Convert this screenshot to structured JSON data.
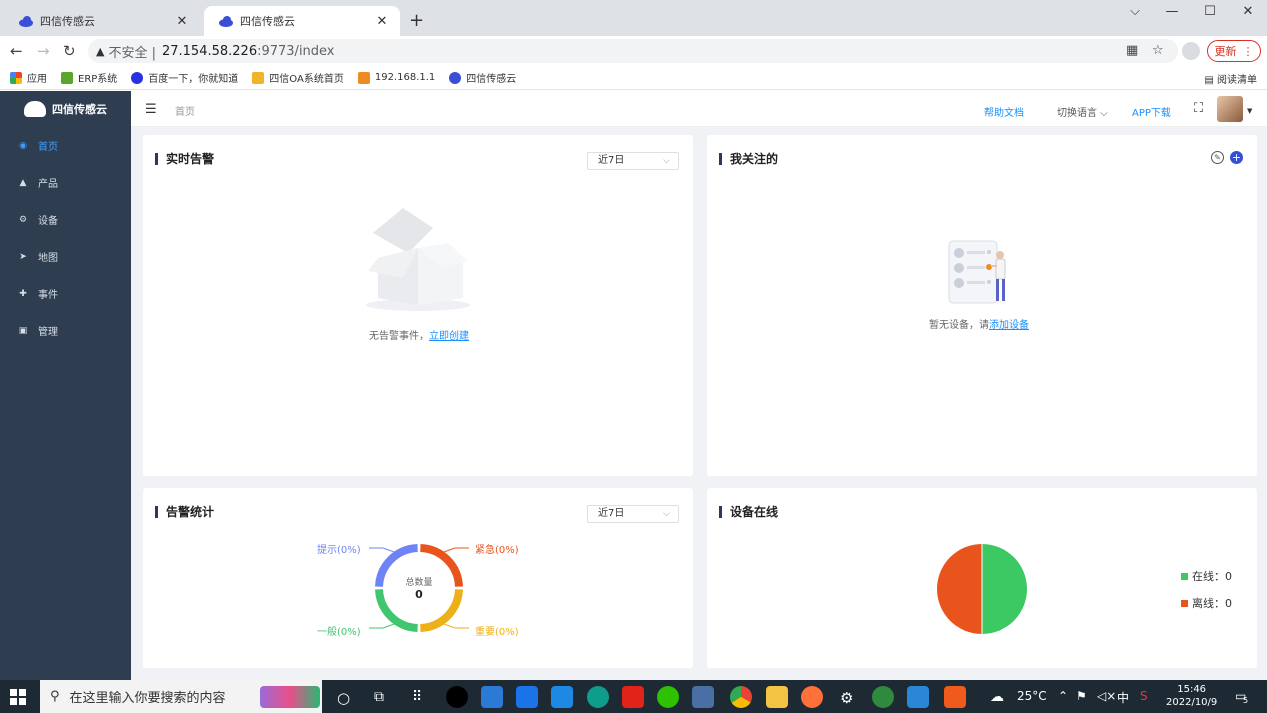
{
  "browser": {
    "tabs": [
      {
        "title": "四信传感云",
        "active": false
      },
      {
        "title": "四信传感云",
        "active": true
      }
    ],
    "new_tab": "+",
    "window_controls": {
      "dropdown": "⌵",
      "minimize": "—",
      "maximize": "☐",
      "close": "✕"
    },
    "address": {
      "warning": "▲",
      "insecure_label": "不安全 |",
      "host": "27.154.58.226",
      "path": ":9773/index"
    },
    "update_button": "更新",
    "bookmarks": [
      {
        "label": "应用",
        "color": "#4285f4"
      },
      {
        "label": "ERP系统",
        "color": "#5aa62c"
      },
      {
        "label": "百度一下，你就知道",
        "color": "#2932e1"
      },
      {
        "label": "四信OA系统首页",
        "color": "#f0b429"
      },
      {
        "label": "192.168.1.1",
        "color": "#f08a24"
      },
      {
        "label": "四信传感云",
        "color": "#3a4fd6"
      }
    ],
    "reading_list": "阅读清单"
  },
  "app": {
    "logo_text": "四信传感云",
    "menu": [
      {
        "label": "首页",
        "icon": "dashboard-icon",
        "glyph": "◉",
        "active": true
      },
      {
        "label": "产品",
        "icon": "product-icon",
        "glyph": "▲",
        "active": false
      },
      {
        "label": "设备",
        "icon": "device-icon",
        "glyph": "⚙",
        "active": false
      },
      {
        "label": "地图",
        "icon": "map-icon",
        "glyph": "➤",
        "active": false
      },
      {
        "label": "事件",
        "icon": "event-icon",
        "glyph": "✚",
        "active": false
      },
      {
        "label": "管理",
        "icon": "manage-icon",
        "glyph": "▣",
        "active": false
      }
    ],
    "header": {
      "breadcrumb": "首页",
      "help": "帮助文档",
      "language": "切换语言 ⌵",
      "app_download": "APP下载",
      "fullscreen": "⛶"
    }
  },
  "cards": {
    "realtime_alarm": {
      "title": "实时告警",
      "range": "近7日",
      "empty_text": "无告警事件，",
      "empty_link": "立即创建"
    },
    "followed": {
      "title": "我关注的",
      "empty_text": "暂无设备，请",
      "empty_link": "添加设备"
    },
    "alarm_stats": {
      "title": "告警统计",
      "range": "近7日",
      "center_label": "总数量",
      "center_value": "0",
      "labels": {
        "hint": "提示(0%)",
        "urgent": "紧急(0%)",
        "normal": "一般(0%)",
        "important": "重要(0%)"
      },
      "colors": {
        "hint": "#6e83f5",
        "urgent": "#e8541c",
        "normal": "#3fc66e",
        "important": "#eeb019"
      }
    },
    "device_online": {
      "title": "设备在线",
      "legend": {
        "online": "在线：0",
        "offline": "离线：0"
      },
      "colors": {
        "online": "#3cc863",
        "offline": "#e8541c"
      }
    }
  },
  "chart_data": [
    {
      "type": "pie",
      "title": "告警统计",
      "categories": [
        "提示",
        "紧急",
        "重要",
        "一般"
      ],
      "values": [
        0,
        0,
        0,
        0
      ],
      "total": 0
    },
    {
      "type": "pie",
      "title": "设备在线",
      "categories": [
        "在线",
        "离线"
      ],
      "values": [
        0,
        0
      ]
    }
  ],
  "taskbar": {
    "search_placeholder": "在这里输入你要搜索的内容",
    "weather": "25°C",
    "ime": "中",
    "time": "15:46",
    "date": "2022/10/9",
    "notifications": "5"
  }
}
